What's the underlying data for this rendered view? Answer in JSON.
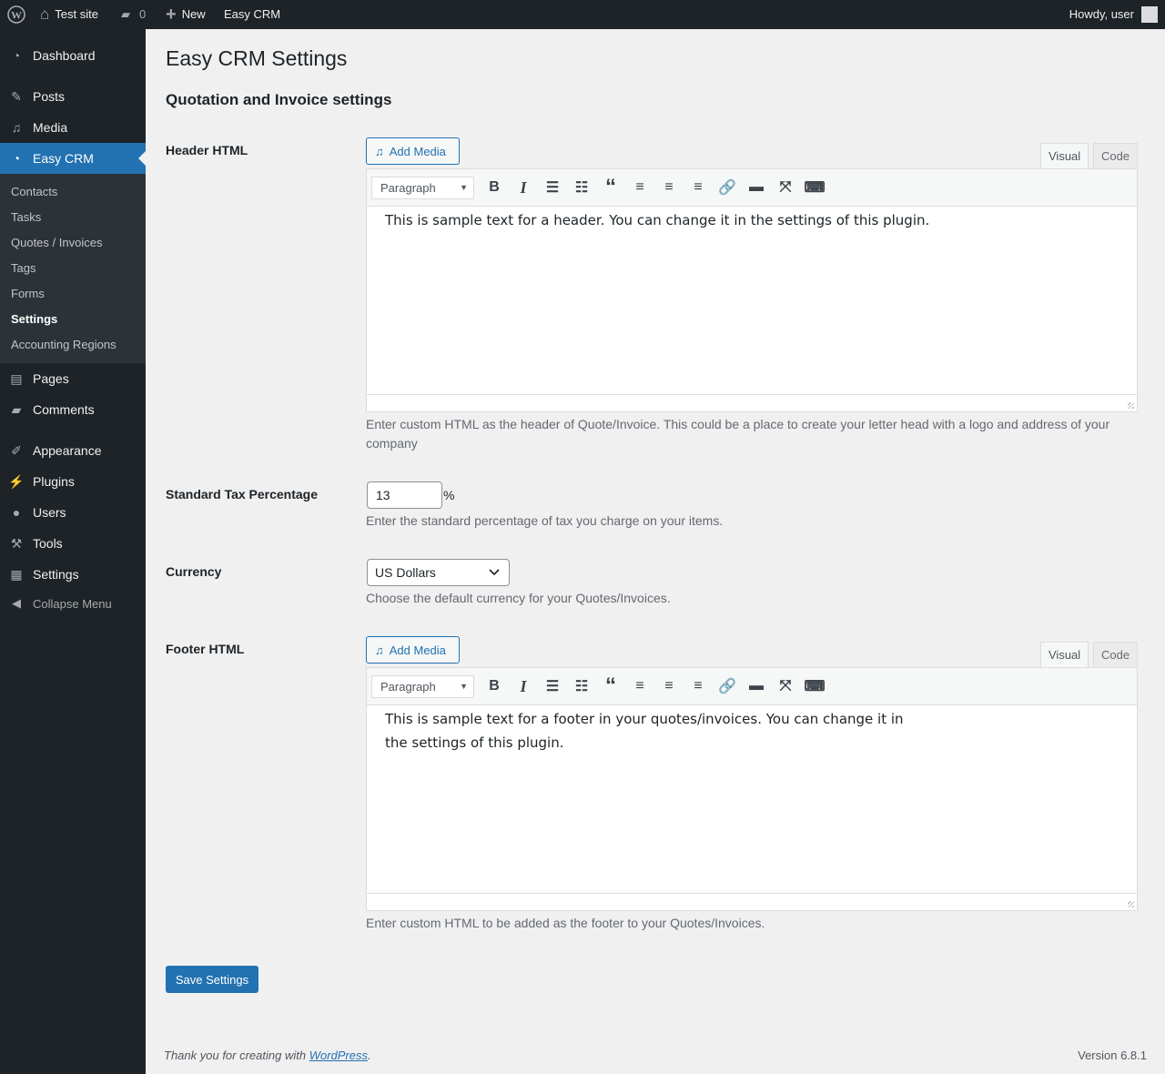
{
  "adminbar": {
    "site": "Test site",
    "comments": "0",
    "new": "New",
    "plugin": "Easy CRM",
    "howdy": "Howdy, user"
  },
  "sidebar": {
    "items": [
      {
        "label": "Dashboard",
        "icon": "dashboard-icon"
      },
      {
        "label": "Posts",
        "icon": "pin-icon"
      },
      {
        "label": "Media",
        "icon": "media-icon"
      },
      {
        "label": "Easy CRM",
        "icon": "dashboard-icon"
      },
      {
        "label": "Pages",
        "icon": "pages-icon"
      },
      {
        "label": "Comments",
        "icon": "comment-icon"
      },
      {
        "label": "Appearance",
        "icon": "brush-icon"
      },
      {
        "label": "Plugins",
        "icon": "plug-icon"
      },
      {
        "label": "Users",
        "icon": "user-icon"
      },
      {
        "label": "Tools",
        "icon": "wrench-icon"
      },
      {
        "label": "Settings",
        "icon": "settings-icon"
      },
      {
        "label": "Collapse Menu",
        "icon": "collapse-icon"
      }
    ],
    "submenu": [
      "Contacts",
      "Tasks",
      "Quotes / Invoices",
      "Tags",
      "Forms",
      "Settings",
      "Accounting Regions"
    ]
  },
  "page": {
    "title": "Easy CRM Settings",
    "section": "Quotation and Invoice settings"
  },
  "editor_common": {
    "add_media": "Add Media",
    "visual": "Visual",
    "code": "Code",
    "format": "Paragraph"
  },
  "header_html": {
    "label": "Header HTML",
    "content": "This is sample text for a header. You can change it in the settings of this plugin.",
    "desc": "Enter custom HTML as the header of Quote/Invoice. This could be a place to create your letter head with a logo and address of your company"
  },
  "tax": {
    "label": "Standard Tax Percentage",
    "value": "13",
    "unit": "%",
    "desc": "Enter the standard percentage of tax you charge on your items."
  },
  "currency": {
    "label": "Currency",
    "value": "US Dollars",
    "desc": "Choose the default currency for your Quotes/Invoices."
  },
  "footer_html": {
    "label": "Footer HTML",
    "content": "This is sample text for a footer in your quotes/invoices. You can change it in the settings of this plugin.",
    "desc": "Enter custom HTML to be added as the footer to your Quotes/Invoices."
  },
  "save": "Save Settings",
  "footer": {
    "thanks": "Thank you for creating with ",
    "link": "WordPress",
    "dot": ".",
    "version": "Version 6.8.1"
  },
  "colors": {
    "accent": "#2271b1",
    "sidebar": "#1d2327"
  }
}
